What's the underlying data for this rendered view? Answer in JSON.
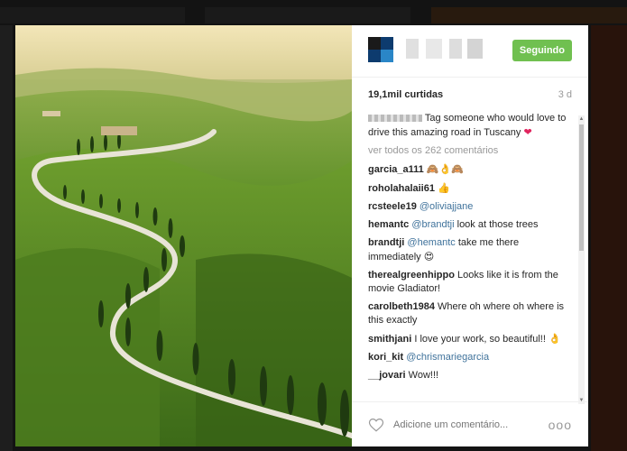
{
  "post": {
    "likes": "19,1mil curtidas",
    "time_ago": "3 d",
    "follow_label": "Seguindo"
  },
  "caption": {
    "text": "Tag someone who would love to drive this amazing road in Tuscany",
    "emoji": "❤"
  },
  "view_all_label": "ver todos os 262 comentários",
  "comments": [
    {
      "user": "garcia_a111",
      "mention": "",
      "text": "",
      "emoji": "🙈👌🙈"
    },
    {
      "user": "roholahalaii61",
      "mention": "",
      "text": "",
      "emoji": "👍"
    },
    {
      "user": "rcsteele19",
      "mention": "@oliviajjane",
      "text": "",
      "emoji": ""
    },
    {
      "user": "hemantc",
      "mention": "@brandtji",
      "text": " look at those trees",
      "emoji": ""
    },
    {
      "user": "brandtji",
      "mention": "@hemantc",
      "text": " take me there immediately",
      "emoji": "😍"
    },
    {
      "user": "therealgreenhippo",
      "mention": "",
      "text": "Looks like it is from the movie Gladiator!",
      "emoji": ""
    },
    {
      "user": "carolbeth1984",
      "mention": "",
      "text": "Where oh where oh where is this exactly",
      "emoji": ""
    },
    {
      "user": "smithjani",
      "mention": "",
      "text": "I love your work, so beautiful!!",
      "emoji": "👌"
    },
    {
      "user": "kori_kit",
      "mention": "@chrismariegarcia",
      "text": "",
      "emoji": ""
    },
    {
      "user": "__jovari",
      "mention": "",
      "text": "Wow!!!",
      "emoji": ""
    }
  ],
  "footer": {
    "placeholder": "Adicione um comentário...",
    "more_label": "ooo"
  },
  "colors": {
    "follow_green": "#70c050",
    "mention_blue": "#3f729b",
    "muted_gray": "#999999"
  },
  "icons": [
    "heart-icon",
    "more-options-icon",
    "avatar"
  ]
}
